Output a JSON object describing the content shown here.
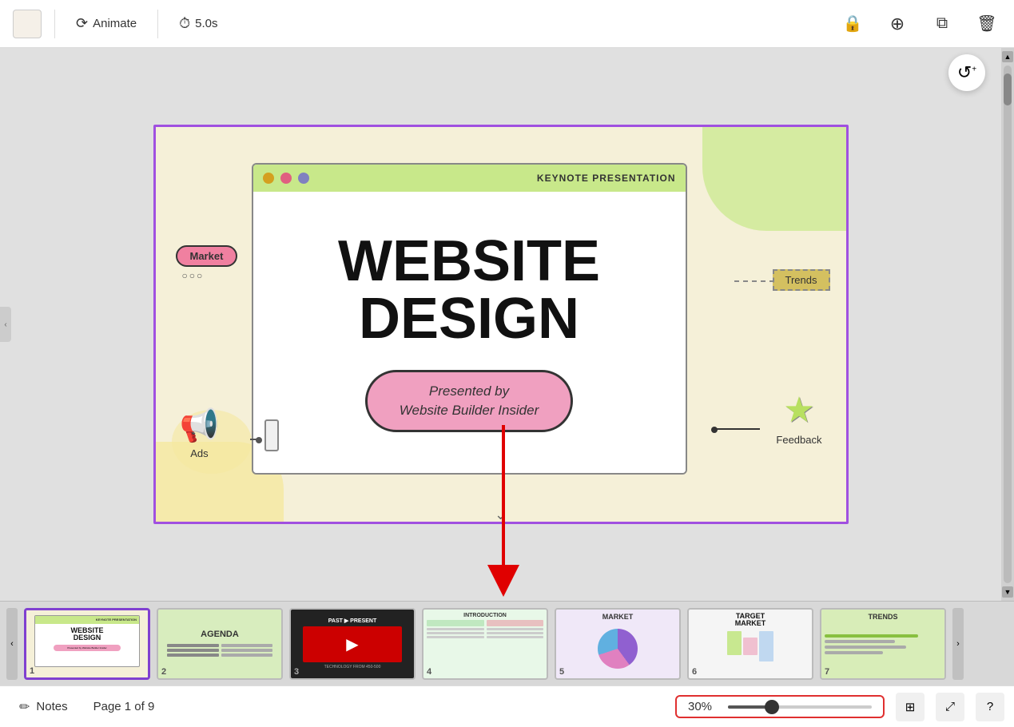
{
  "toolbar": {
    "animate_label": "Animate",
    "duration_label": "5.0s",
    "lock_icon": "🔒",
    "add_icon": "＋",
    "duplicate_icon": "⧉",
    "delete_icon": "🗑"
  },
  "canvas": {
    "refresh_icon": "↺",
    "chevron_down": "∨",
    "slide": {
      "browser_title": "KEYNOTE PRESENTATION",
      "main_title_line1": "WEBSITE",
      "main_title_line2": "DESIGN",
      "subtitle": "Presented by\nWebsite Builder Insider",
      "annotation_market": "Market",
      "annotation_market_dots": "○○○",
      "annotation_trends": "Trends",
      "annotation_ads": "Ads",
      "annotation_feedback": "Feedback"
    }
  },
  "thumbnails": [
    {
      "num": "1",
      "label": "WEBSITE\nDESIGN",
      "active": true,
      "bg": "cream"
    },
    {
      "num": "2",
      "label": "AGENDA",
      "active": false,
      "bg": "green"
    },
    {
      "num": "3",
      "label": "PAST ▶ PRESENT",
      "active": false,
      "bg": "dark"
    },
    {
      "num": "4",
      "label": "INTRODUCTION",
      "active": false,
      "bg": "intro"
    },
    {
      "num": "5",
      "label": "MARKET",
      "active": false,
      "bg": "chart"
    },
    {
      "num": "6",
      "label": "TARGET MARKET",
      "active": false,
      "bg": "target"
    },
    {
      "num": "7",
      "label": "TRENDS",
      "active": false,
      "bg": "green2"
    }
  ],
  "statusbar": {
    "notes_icon": "✏",
    "notes_label": "Notes",
    "page_label": "Page 1 of 9",
    "zoom_value": "30%",
    "grid_icon": "⊞",
    "expand_icon": "⤢",
    "help_icon": "?"
  }
}
